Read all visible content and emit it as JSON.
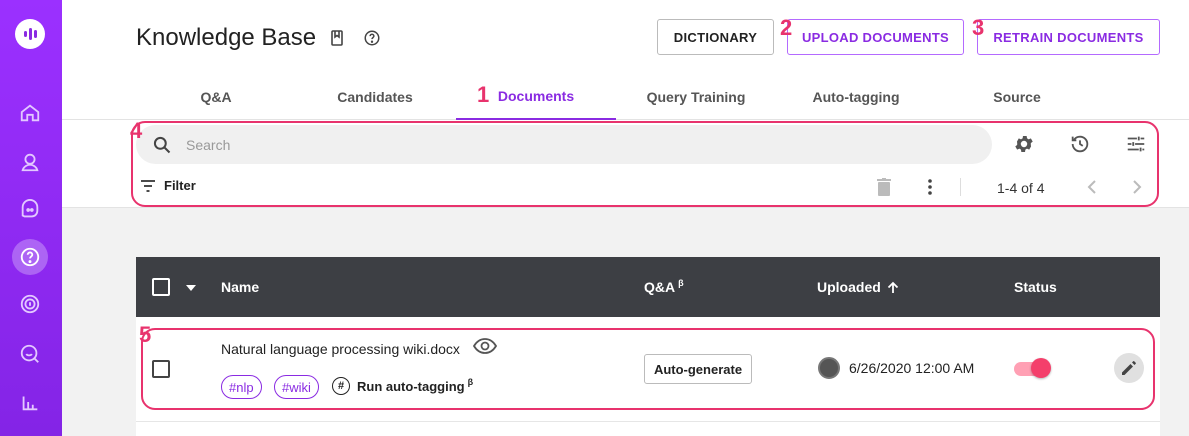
{
  "header": {
    "title": "Knowledge Base",
    "dictionary_label": "DICTIONARY",
    "upload_label": "UPLOAD DOCUMENTS",
    "retrain_label": "RETRAIN DOCUMENTS"
  },
  "tabs": [
    {
      "label": "Q&A"
    },
    {
      "label": "Candidates"
    },
    {
      "label": "Documents",
      "active": true
    },
    {
      "label": "Query Training"
    },
    {
      "label": "Auto-tagging"
    },
    {
      "label": "Source"
    }
  ],
  "toolbar": {
    "search_placeholder": "Search",
    "filter_label": "Filter",
    "pagination": "1-4 of 4"
  },
  "table": {
    "columns": {
      "name": "Name",
      "qa": "Q&A",
      "qa_superscript": "β",
      "uploaded": "Uploaded",
      "status": "Status"
    },
    "rows": [
      {
        "name": "Natural language processing wiki.docx",
        "tags": [
          "#nlp",
          "#wiki"
        ],
        "run_tagging": "Run auto-tagging",
        "run_tagging_superscript": "β",
        "qa_button": "Auto-generate",
        "uploaded": "6/26/2020 12:00 AM",
        "status_on": true
      }
    ]
  },
  "callouts": [
    "1",
    "2",
    "3",
    "4",
    "5"
  ],
  "colors": {
    "accent": "#8a2be2",
    "callout": "#e8336d",
    "header_row": "#3d3f44",
    "toggle": "#f43f6b"
  },
  "icons": [
    "logo-icon",
    "home-icon",
    "user-icon",
    "chat-icon",
    "help-icon",
    "fingerprint-icon",
    "search-chat-icon",
    "analytics-icon",
    "book-icon",
    "help-circle-icon",
    "search-icon",
    "gear-icon",
    "history-icon",
    "tune-icon",
    "filter-icon",
    "trash-icon",
    "more-vert-icon",
    "chevron-left-icon",
    "chevron-right-icon",
    "caret-down-icon",
    "arrow-up-icon",
    "eye-icon",
    "hash-icon",
    "pencil-icon"
  ]
}
